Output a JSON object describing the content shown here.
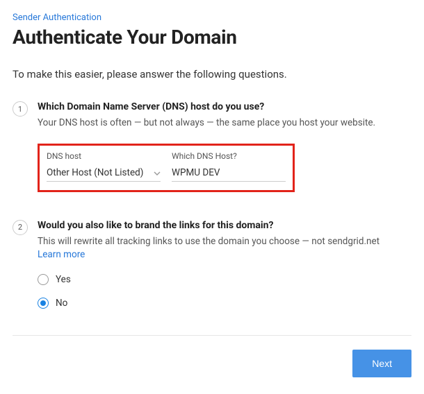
{
  "breadcrumb": "Sender Authentication",
  "title": "Authenticate Your Domain",
  "intro": "To make this easier, please answer the following questions.",
  "step1": {
    "number": "1",
    "title": "Which Domain Name Server (DNS) host do you use?",
    "desc": "Your DNS host is often — but not always — the same place you host your website.",
    "dns_host_label": "DNS host",
    "dns_host_value": "Other Host (Not Listed)",
    "which_dns_label": "Which DNS Host?",
    "which_dns_value": "WPMU DEV"
  },
  "step2": {
    "number": "2",
    "title": "Would you also like to brand the links for this domain?",
    "desc": "This will rewrite all tracking links to use the domain you choose — not sendgrid.net",
    "learn_more": "Learn more",
    "yes_label": "Yes",
    "no_label": "No",
    "selected": "no"
  },
  "footer": {
    "next": "Next"
  }
}
